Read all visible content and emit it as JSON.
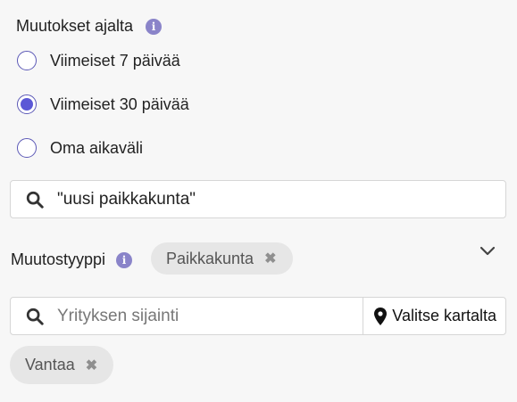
{
  "time_filter": {
    "label": "Muutokset ajalta",
    "info_icon": "info-icon",
    "options": [
      {
        "label": "Viimeiset 7 päivää",
        "selected": false
      },
      {
        "label": "Viimeiset 30 päivää",
        "selected": true
      },
      {
        "label": "Oma aikaväli",
        "selected": false
      }
    ]
  },
  "keyword_search": {
    "value": "\"uusi paikkakunta\"",
    "icon": "search-icon"
  },
  "change_type": {
    "label": "Muutostyyppi",
    "info_icon": "info-icon",
    "chips": [
      {
        "label": "Paikkakunta"
      }
    ],
    "expand_icon": "chevron-down-icon"
  },
  "location": {
    "placeholder": "Yrityksen sijainti",
    "value": "",
    "map_button_label": "Valitse kartalta",
    "map_icon": "map-pin-icon",
    "chips": [
      {
        "label": "Vantaa"
      }
    ]
  },
  "colors": {
    "accent": "#5b58d6",
    "info_icon": "#8a84c9",
    "chip_bg": "#e6e6e6",
    "page_bg": "#f7f7f7"
  }
}
